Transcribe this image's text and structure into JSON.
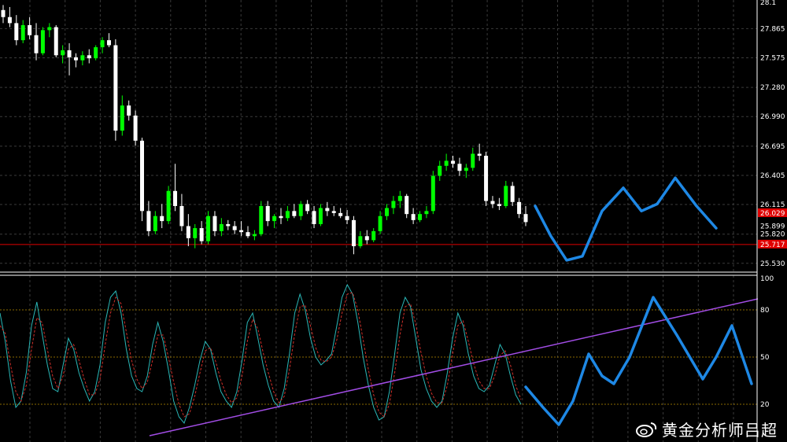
{
  "watermark": {
    "text": "黄金分析师吕超",
    "icon": "weibo-icon"
  },
  "colors": {
    "background": "#000000",
    "grid": "#3a3a3a",
    "bull": "#00ff00",
    "bear": "#ffffff",
    "drawing": "#1e88e5",
    "trendline": "#a24de6",
    "support": "#e00000",
    "k_line": "#29b6b6",
    "d_line": "#d0302a",
    "level_line": "#8a6a00"
  },
  "chart_data": [
    {
      "type": "candlestick",
      "title": "",
      "y_ticks": [
        "27.865",
        "27.575",
        "27.280",
        "26.990",
        "26.695",
        "26.405",
        "26.115",
        "25.820",
        "25.530"
      ],
      "y_range": [
        25.45,
        28.15
      ],
      "top_label_partial": "28.1",
      "price_labels": [
        {
          "value": "26.029",
          "color": "#e00000"
        },
        {
          "value": "25.899",
          "color": "#ffffff"
        },
        {
          "value": "25.717",
          "color": "#e00000"
        }
      ],
      "support_level": 25.717,
      "ohlc": [
        [
          28.05,
          28.1,
          27.92,
          27.98
        ],
        [
          27.98,
          28.08,
          27.88,
          27.92
        ],
        [
          27.92,
          28.0,
          27.7,
          27.75
        ],
        [
          27.75,
          27.95,
          27.72,
          27.9
        ],
        [
          27.9,
          27.98,
          27.76,
          27.8
        ],
        [
          27.8,
          27.92,
          27.55,
          27.62
        ],
        [
          27.62,
          27.88,
          27.6,
          27.85
        ],
        [
          27.85,
          27.92,
          27.78,
          27.88
        ],
        [
          27.88,
          27.9,
          27.58,
          27.6
        ],
        [
          27.6,
          27.7,
          27.52,
          27.65
        ],
        [
          27.65,
          27.72,
          27.4,
          27.58
        ],
        [
          27.58,
          27.62,
          27.48,
          27.55
        ],
        [
          27.55,
          27.64,
          27.5,
          27.6
        ],
        [
          27.6,
          27.66,
          27.52,
          27.57
        ],
        [
          27.57,
          27.7,
          27.55,
          27.68
        ],
        [
          27.68,
          27.78,
          27.62,
          27.75
        ],
        [
          27.75,
          27.82,
          27.68,
          27.7
        ],
        [
          27.7,
          27.76,
          26.75,
          26.85
        ],
        [
          26.85,
          27.2,
          26.8,
          27.1
        ],
        [
          27.1,
          27.15,
          26.95,
          27.0
        ],
        [
          27.0,
          27.05,
          26.7,
          26.75
        ],
        [
          26.75,
          26.78,
          25.95,
          26.05
        ],
        [
          26.05,
          26.15,
          25.8,
          25.85
        ],
        [
          25.85,
          26.05,
          25.82,
          26.0
        ],
        [
          26.0,
          26.12,
          25.88,
          25.95
        ],
        [
          25.95,
          26.3,
          25.92,
          26.25
        ],
        [
          26.25,
          26.52,
          26.05,
          26.1
        ],
        [
          26.1,
          26.22,
          25.85,
          25.9
        ],
        [
          25.9,
          26.02,
          25.7,
          25.78
        ],
        [
          25.78,
          25.92,
          25.68,
          25.88
        ],
        [
          25.88,
          25.95,
          25.72,
          25.75
        ],
        [
          25.75,
          26.05,
          25.72,
          26.0
        ],
        [
          26.0,
          26.05,
          25.8,
          25.85
        ],
        [
          25.85,
          25.98,
          25.8,
          25.92
        ],
        [
          25.92,
          25.96,
          25.86,
          25.9
        ],
        [
          25.9,
          25.95,
          25.82,
          25.86
        ],
        [
          25.86,
          25.95,
          25.8,
          25.84
        ],
        [
          25.84,
          25.9,
          25.78,
          25.8
        ],
        [
          25.8,
          25.86,
          25.76,
          25.82
        ],
        [
          25.82,
          26.15,
          25.8,
          26.1
        ],
        [
          26.1,
          26.15,
          25.9,
          25.95
        ],
        [
          25.95,
          26.02,
          25.88,
          26.0
        ],
        [
          26.0,
          26.08,
          25.92,
          25.98
        ],
        [
          25.98,
          26.1,
          25.95,
          26.05
        ],
        [
          26.05,
          26.12,
          25.98,
          26.0
        ],
        [
          26.0,
          26.15,
          25.96,
          26.12
        ],
        [
          26.12,
          26.16,
          26.02,
          26.05
        ],
        [
          26.05,
          26.1,
          25.88,
          25.92
        ],
        [
          25.92,
          26.12,
          25.9,
          26.08
        ],
        [
          26.08,
          26.14,
          26.0,
          26.05
        ],
        [
          26.05,
          26.1,
          26.0,
          26.03
        ],
        [
          26.03,
          26.08,
          25.98,
          26.0
        ],
        [
          26.0,
          26.06,
          25.92,
          25.96
        ],
        [
          25.96,
          26.0,
          25.62,
          25.7
        ],
        [
          25.7,
          25.85,
          25.68,
          25.8
        ],
        [
          25.8,
          25.86,
          25.72,
          25.76
        ],
        [
          25.76,
          25.88,
          25.74,
          25.85
        ],
        [
          25.85,
          26.05,
          25.82,
          26.0
        ],
        [
          26.0,
          26.12,
          25.96,
          26.08
        ],
        [
          26.08,
          26.2,
          26.02,
          26.15
        ],
        [
          26.15,
          26.25,
          26.08,
          26.2
        ],
        [
          26.2,
          26.22,
          25.98,
          26.02
        ],
        [
          26.02,
          26.08,
          25.92,
          25.96
        ],
        [
          25.96,
          26.05,
          25.94,
          26.02
        ],
        [
          26.02,
          26.1,
          25.98,
          26.05
        ],
        [
          26.05,
          26.45,
          26.02,
          26.4
        ],
        [
          26.4,
          26.55,
          26.35,
          26.5
        ],
        [
          26.5,
          26.62,
          26.45,
          26.55
        ],
        [
          26.55,
          26.6,
          26.48,
          26.52
        ],
        [
          26.52,
          26.58,
          26.4,
          26.45
        ],
        [
          26.45,
          26.52,
          26.38,
          26.48
        ],
        [
          26.48,
          26.68,
          26.45,
          26.62
        ],
        [
          26.62,
          26.72,
          26.55,
          26.6
        ],
        [
          26.6,
          26.64,
          26.1,
          26.15
        ],
        [
          26.15,
          26.2,
          26.08,
          26.12
        ],
        [
          26.12,
          26.18,
          26.06,
          26.1
        ],
        [
          26.1,
          26.35,
          26.08,
          26.3
        ],
        [
          26.3,
          26.34,
          26.1,
          26.14
        ],
        [
          26.14,
          26.18,
          25.98,
          26.02
        ],
        [
          26.02,
          26.1,
          25.9,
          25.94
        ]
      ]
    },
    {
      "type": "line",
      "title": "",
      "y_ticks": [
        "100",
        "80",
        "50",
        "20"
      ],
      "y_range": [
        0,
        100
      ],
      "levels": [
        80,
        50,
        20
      ],
      "series": [
        {
          "values": [
            78,
            60,
            35,
            18,
            22,
            40,
            70,
            85,
            65,
            45,
            30,
            28,
            45,
            62,
            55,
            40,
            30,
            22,
            28,
            45,
            72,
            88,
            92,
            78,
            55,
            38,
            30,
            28,
            38,
            58,
            72,
            60,
            42,
            22,
            12,
            8,
            18,
            32,
            48,
            60,
            55,
            40,
            28,
            22,
            18,
            28,
            48,
            72,
            78,
            62,
            45,
            32,
            22,
            18,
            30,
            52,
            78,
            90,
            80,
            62,
            50,
            45,
            48,
            52,
            70,
            88,
            96,
            90,
            72,
            50,
            32,
            18,
            10,
            12,
            28,
            52,
            78,
            88,
            82,
            62,
            42,
            30,
            22,
            18,
            22,
            40,
            62,
            78,
            70,
            52,
            38,
            30,
            28,
            32,
            45,
            58,
            52,
            38,
            26,
            20
          ]
        },
        {
          "values": [
            70,
            65,
            45,
            28,
            22,
            32,
            55,
            75,
            72,
            55,
            38,
            30,
            38,
            55,
            58,
            48,
            36,
            26,
            26,
            36,
            58,
            78,
            88,
            84,
            66,
            48,
            36,
            30,
            34,
            48,
            64,
            64,
            50,
            34,
            20,
            12,
            14,
            25,
            40,
            54,
            56,
            47,
            35,
            26,
            21,
            24,
            38,
            60,
            74,
            68,
            53,
            40,
            28,
            21,
            25,
            42,
            65,
            82,
            83,
            70,
            56,
            48,
            47,
            50,
            61,
            78,
            90,
            91,
            80,
            61,
            42,
            26,
            15,
            12,
            20,
            40,
            64,
            82,
            84,
            71,
            53,
            38,
            27,
            21,
            21,
            32,
            52,
            70,
            73,
            60,
            46,
            35,
            30,
            30,
            38,
            51,
            54,
            45,
            32,
            23
          ]
        }
      ],
      "trendline": {
        "x_start": 0.19,
        "y_start": 0,
        "x_end": 0.963,
        "y_end": 87
      },
      "forecast": [
        [
          0.668,
          31
        ],
        [
          0.69,
          18
        ],
        [
          0.71,
          7
        ],
        [
          0.728,
          22
        ],
        [
          0.748,
          52
        ],
        [
          0.765,
          38
        ],
        [
          0.78,
          33
        ],
        [
          0.8,
          50
        ],
        [
          0.83,
          88
        ],
        [
          0.86,
          64
        ],
        [
          0.893,
          36
        ],
        [
          0.91,
          50
        ],
        [
          0.93,
          70
        ],
        [
          0.955,
          33
        ]
      ]
    }
  ]
}
